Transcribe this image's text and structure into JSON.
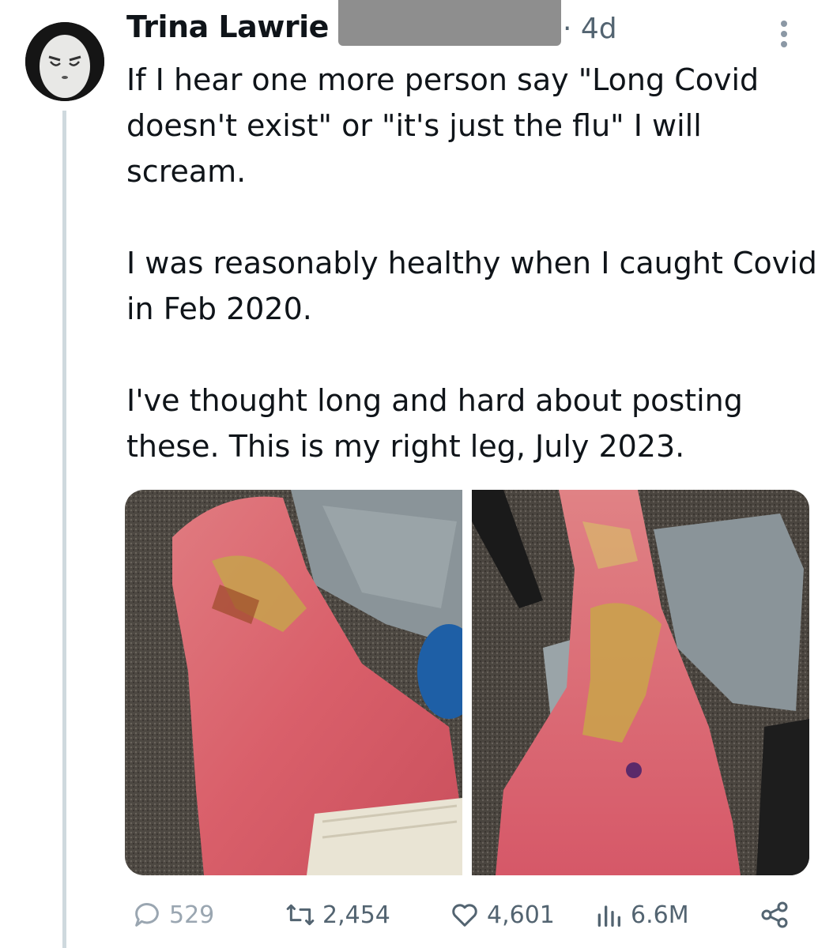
{
  "tweet": {
    "author_name": "Trina Lawrie",
    "time": "· 4d",
    "paragraphs": [
      "If I hear one more person say \"Long Covid doesn't exist\" or \"it's just the flu\" I will scream.",
      "I was reasonably healthy when I caught Covid in Feb 2020.",
      "I've thought long and hard about posting these. This is my right leg, July 2023."
    ]
  },
  "actions": {
    "replies": "529",
    "reposts": "2,454",
    "likes": "4,601",
    "views": "6.6M"
  },
  "icons": {
    "reply": "speech-bubble-icon",
    "repost": "retweet-arrows-icon",
    "like": "heart-icon",
    "views": "bar-chart-icon",
    "share": "share-icon",
    "more": "more-vertical-icon"
  },
  "colors": {
    "text": "#0f1419",
    "secondary": "#536471",
    "thread_line": "#cfd9de"
  }
}
